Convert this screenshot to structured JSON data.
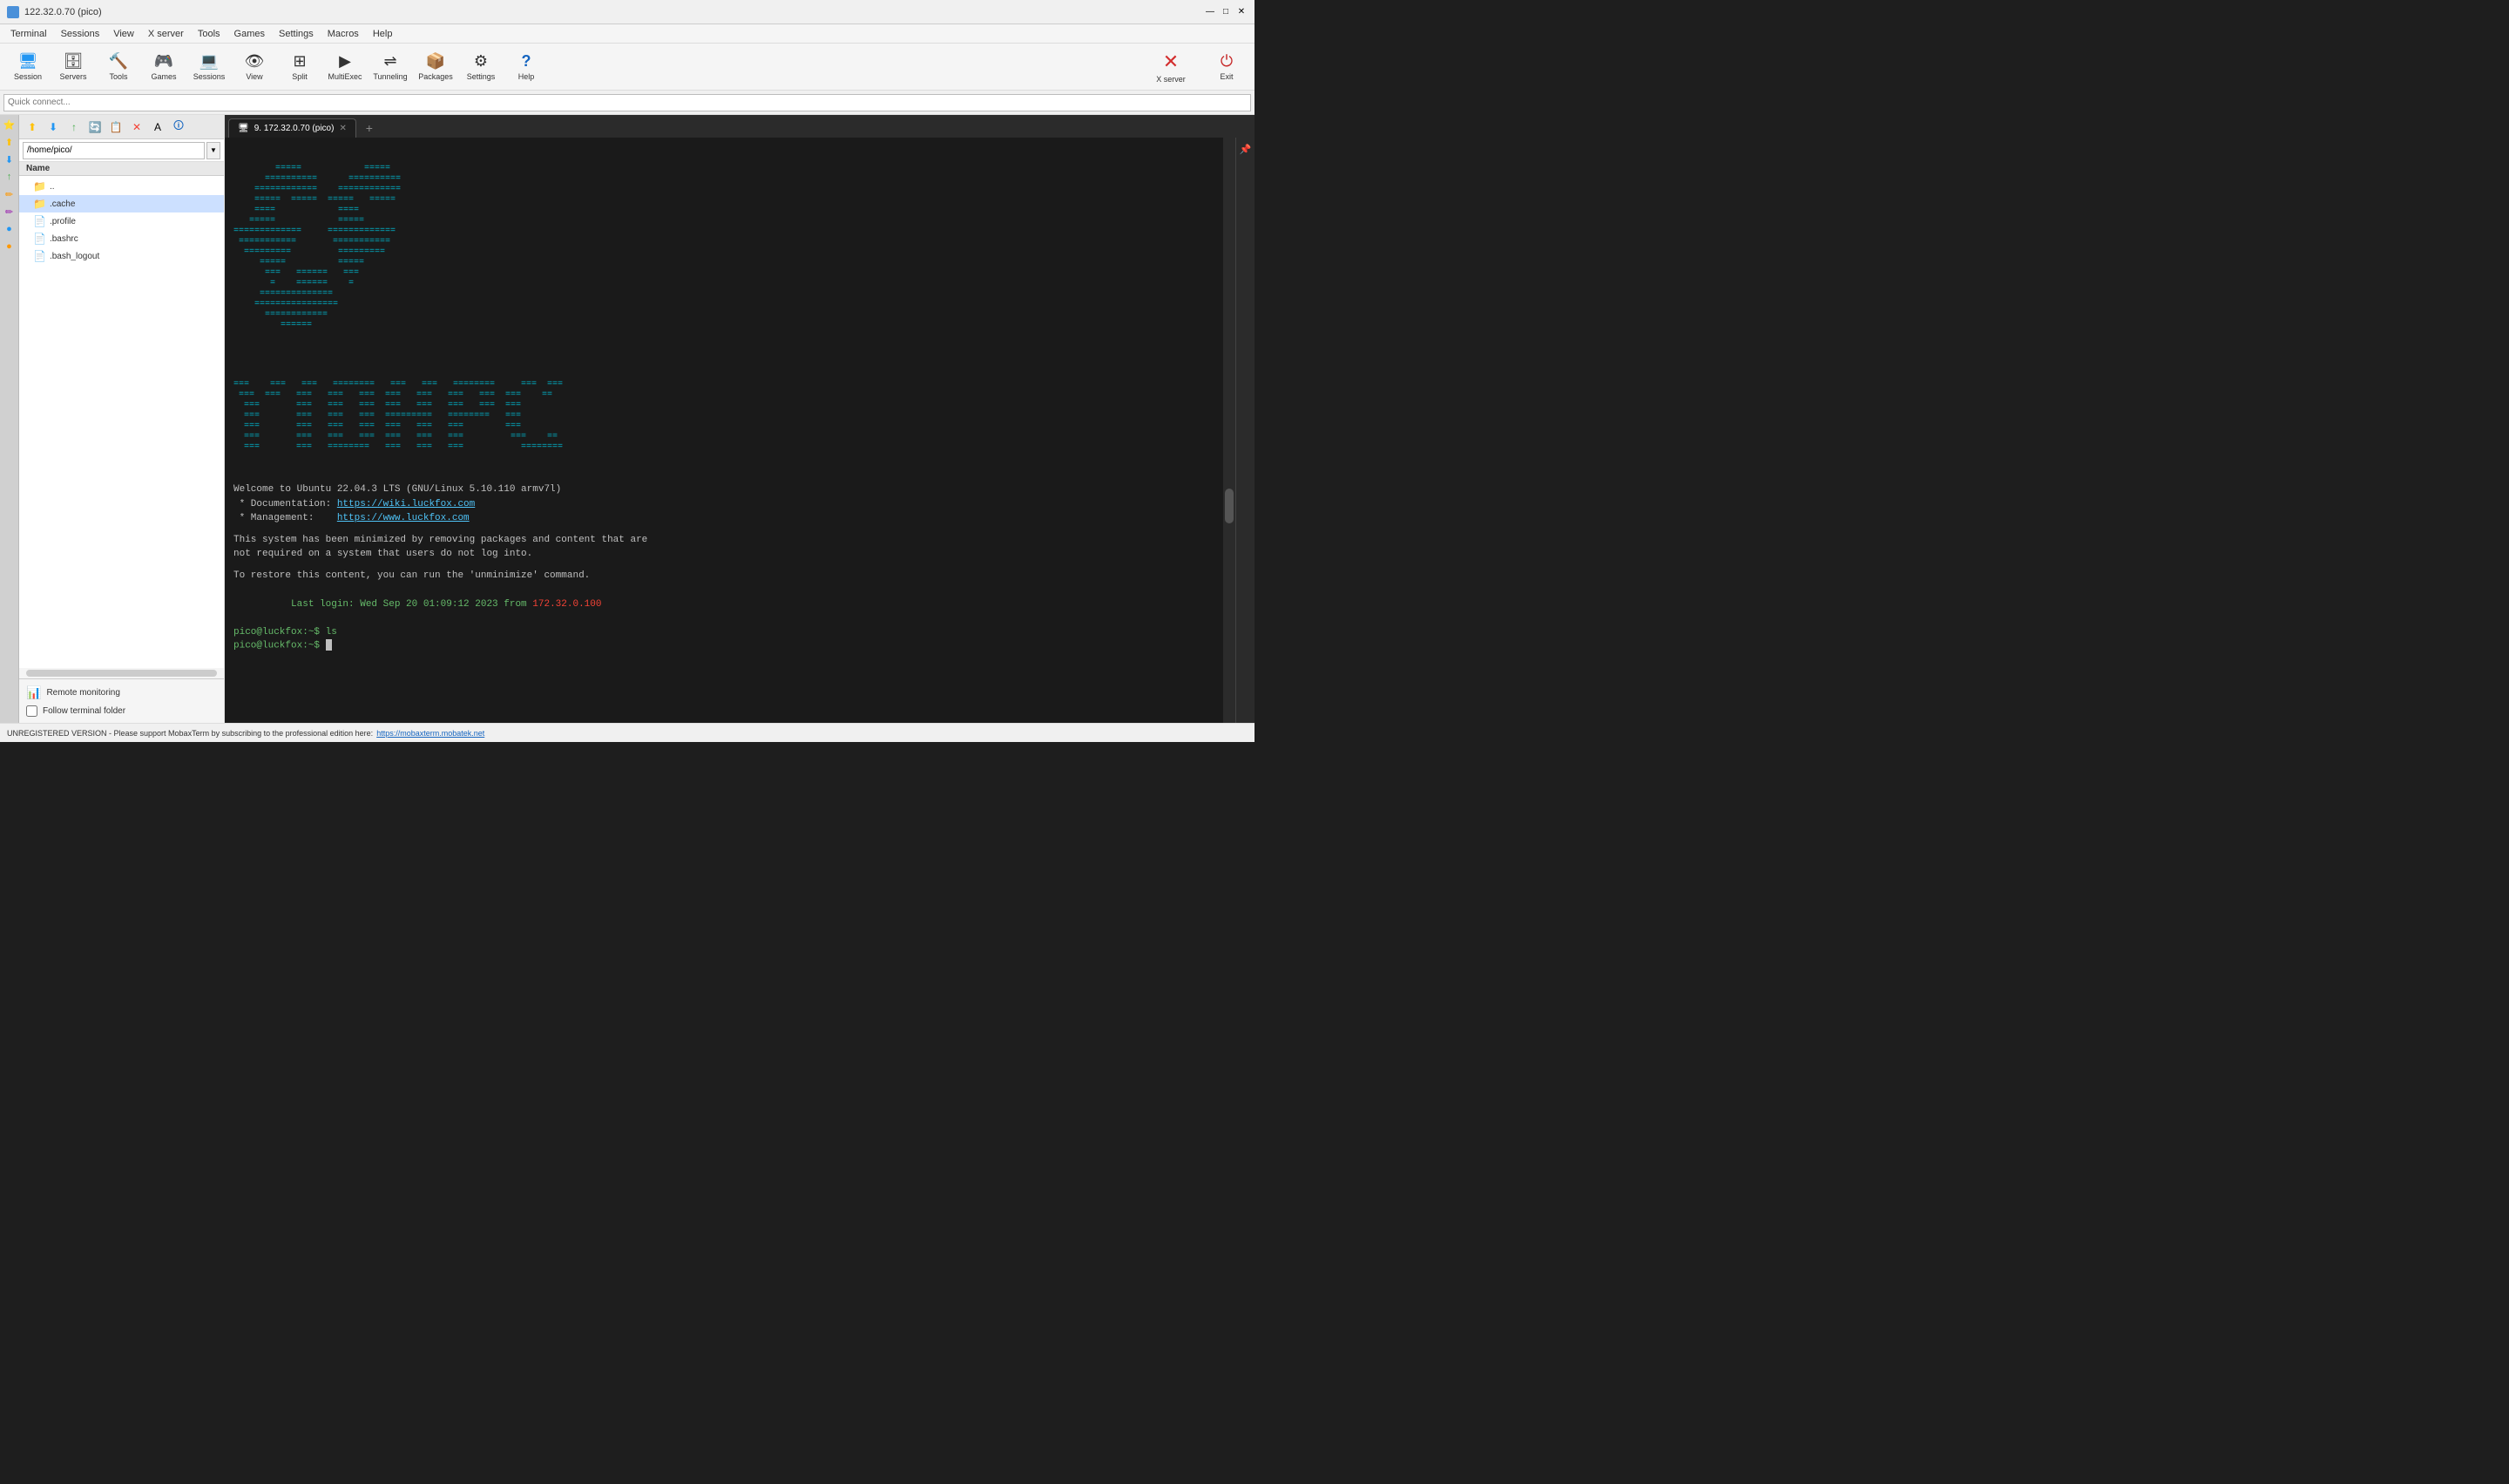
{
  "window": {
    "title": "122.32.0.70 (pico)",
    "icon": "🖥"
  },
  "title_controls": {
    "minimize": "—",
    "maximize": "□",
    "close": "✕"
  },
  "menu": {
    "items": [
      "Terminal",
      "Sessions",
      "View",
      "X server",
      "Tools",
      "Games",
      "Settings",
      "Macros",
      "Help"
    ]
  },
  "toolbar": {
    "buttons": [
      {
        "label": "Session",
        "icon": "🖥",
        "class": "ico-session"
      },
      {
        "label": "Servers",
        "icon": "🗄",
        "class": "ico-servers"
      },
      {
        "label": "Tools",
        "icon": "🔨",
        "class": "ico-tools"
      },
      {
        "label": "Games",
        "icon": "🎮",
        "class": "ico-games"
      },
      {
        "label": "Sessions",
        "icon": "💻",
        "class": "ico-sessions"
      },
      {
        "label": "View",
        "icon": "👁",
        "class": "ico-view"
      },
      {
        "label": "Split",
        "icon": "⊞",
        "class": "ico-split"
      },
      {
        "label": "MultiExec",
        "icon": "▶",
        "class": "ico-multi"
      },
      {
        "label": "Tunneling",
        "icon": "⇌",
        "class": "ico-tunnel"
      },
      {
        "label": "Packages",
        "icon": "📦",
        "class": "ico-pkg"
      },
      {
        "label": "Settings",
        "icon": "⚙",
        "class": "ico-settings"
      },
      {
        "label": "Help",
        "icon": "?",
        "class": "ico-help"
      }
    ],
    "xserver_label": "X server",
    "exit_label": "Exit"
  },
  "quick_connect": {
    "placeholder": "Quick connect..."
  },
  "sidebar": {
    "toolbar_buttons": [
      "⬆",
      "⬇",
      "↑",
      "🔄",
      "📋",
      "✕",
      "A",
      "🛈"
    ],
    "path": "/home/pico/",
    "column_header": "Name",
    "files": [
      {
        "name": "..",
        "type": "folder_up",
        "icon": "📁"
      },
      {
        "name": ".cache",
        "type": "folder",
        "icon": "📁"
      },
      {
        "name": ".profile",
        "type": "file",
        "icon": "📄"
      },
      {
        "name": ".bashrc",
        "type": "file",
        "icon": "📄"
      },
      {
        "name": ".bash_logout",
        "type": "file",
        "icon": "📄"
      }
    ],
    "remote_monitoring_label": "Remote monitoring",
    "follow_terminal_label": "Follow terminal folder"
  },
  "tab": {
    "label": "9. 172.32.0.70 (pico)",
    "icon": "🖥"
  },
  "terminal": {
    "welcome": "Welcome to Ubuntu 22.04.3 LTS (GNU/Linux 5.10.110 armv7l)",
    "doc_label": " * Documentation:",
    "doc_url": "https://wiki.luckfox.com",
    "mgmt_label": " * Management:   ",
    "mgmt_url": "https://www.luckfox.com",
    "minimize_msg": "This system has been minimized by removing packages and content that are",
    "minimize_msg2": "not required on a system that users do not log into.",
    "restore_msg": "To restore this content, you can run the 'unminimize' command.",
    "last_login_prefix": "Last login: Wed Sep 20 01:09:12 2023 from ",
    "last_login_ip": "172.32.0.100",
    "prompt1": "pico@luckfox:~$ ls",
    "prompt2": "pico@luckfox:~$ "
  },
  "status_bar": {
    "text": "UNREGISTERED VERSION  -  Please support MobaxTerm by subscribing to the professional edition here:",
    "link": "https://mobaxterm.mobatek.net"
  }
}
